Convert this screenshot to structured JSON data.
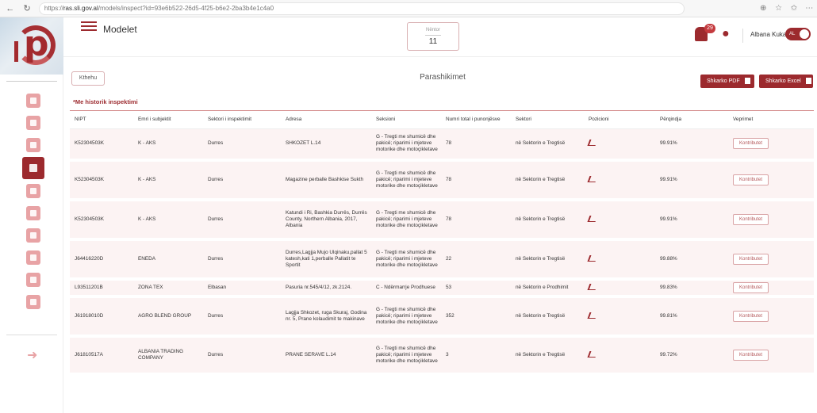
{
  "browser": {
    "url_prefix": "https://",
    "url_domain": "ras.sli.gov.al",
    "url_path": "/models/inspect?id=93e6b522-26d5-4f25-b6e2-2ba3b4e1c4a0"
  },
  "header": {
    "title": "Modelet",
    "month_label": "Nëntor",
    "month_value": "11",
    "notification_count": "29",
    "user_name": "Albana Kuka",
    "lang": "AL"
  },
  "page": {
    "back_label": "Kthehu",
    "heading": "Parashikimet",
    "pdf_label": "Shkarko PDF",
    "excel_label": "Shkarko Excel",
    "history_label": "*Me historik inspektimi"
  },
  "table": {
    "columns": [
      "NIPT",
      "Emri i subjektit",
      "Sektori i inspektimit",
      "Adresa",
      "Seksioni",
      "Numri total i punonjësve",
      "Sektori",
      "Pozicioni",
      "Përqindja",
      "Veprimet"
    ],
    "action_label": "Kontributet",
    "rows": [
      {
        "nipt": "K52304503K",
        "name": "K - AKS",
        "sector": "Durres",
        "address": "SHKOZET L.14",
        "section": "G - Tregti me shumicë dhe pakicë; riparimi i mjeteve motorike dhe motoçikletave",
        "employees": "78",
        "sektori": "në Sektorin e Tregtisë",
        "percent": "99.91%"
      },
      {
        "nipt": "K52304503K",
        "name": "K - AKS",
        "sector": "Durres",
        "address": "Magazine perballe Bashkise Sukth",
        "section": "G - Tregti me shumicë dhe pakicë; riparimi i mjeteve motorike dhe motoçikletave",
        "employees": "78",
        "sektori": "në Sektorin e Tregtisë",
        "percent": "99.91%"
      },
      {
        "nipt": "K52304503K",
        "name": "K - AKS",
        "sector": "Durres",
        "address": "Katundi i Ri, Bashkia Durrës, Durrës County, Northern Albania, 2017, Albania",
        "section": "G - Tregti me shumicë dhe pakicë; riparimi i mjeteve motorike dhe motoçikletave",
        "employees": "78",
        "sektori": "në Sektorin e Tregtisë",
        "percent": "99.91%"
      },
      {
        "nipt": "J64416220D",
        "name": "ENEDA",
        "sector": "Durres",
        "address": "Durres,Lagjja Mujo Ulqinaku,pallat 5 katesh,kati 1,perballe Pallatit te Sportit",
        "section": "G - Tregti me shumicë dhe pakicë; riparimi i mjeteve motorike dhe motoçikletave",
        "employees": "22",
        "sektori": "në Sektorin e Tregtisë",
        "percent": "99.88%"
      },
      {
        "nipt": "L93511201B",
        "name": "ZONA TEX",
        "sector": "Elbasan",
        "address": "Pasuria nr.545/4/12, zk.2124.",
        "section": "C - Ndërmarrje Prodhuese",
        "employees": "53",
        "sektori": "në Sektorin e Prodhimit",
        "percent": "99.83%"
      },
      {
        "nipt": "J61918010D",
        "name": "AGRO BLEND GROUP",
        "sector": "Durres",
        "address": "Lagjja Shkozet, ruga Skuraj, Godina nr. 5, Prane kolaudimit te makinave",
        "section": "G - Tregti me shumicë dhe pakicë; riparimi i mjeteve motorike dhe motoçikletave",
        "employees": "352",
        "sektori": "në Sektorin e Tregtisë",
        "percent": "99.81%"
      },
      {
        "nipt": "J61810517A",
        "name": "ALBANIA TRADING COMPANY",
        "sector": "Durres",
        "address": "PRANE SERAVE L.14",
        "section": "G - Tregti me shumicë dhe pakicë; riparimi i mjeteve motorike dhe motoçikletave",
        "employees": "3",
        "sektori": "në Sektorin e Tregtisë",
        "percent": "99.72%"
      }
    ]
  },
  "colors": {
    "brand": "#9c2a2e",
    "row_bg": "#fcf3f3",
    "sidebar_icon": "#e8a3a5"
  },
  "icons": {
    "pdf": "file-pdf-icon",
    "excel": "file-excel-icon",
    "position": "chart-icon",
    "notifications": "bell-icon",
    "user": "user-icon",
    "logout": "logout-icon"
  }
}
